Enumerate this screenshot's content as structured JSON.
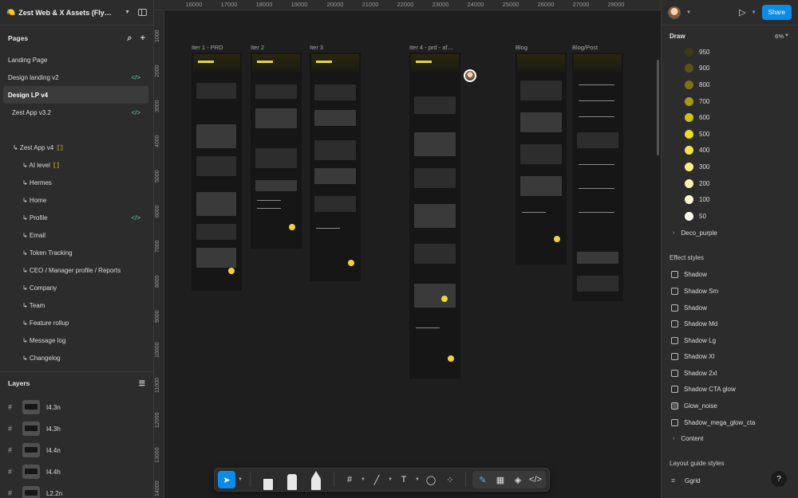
{
  "file": {
    "title": "Zest Web & X Assets (Fly…",
    "emoji_icon": "lemon-icon"
  },
  "pages": {
    "heading": "Pages",
    "items": [
      {
        "label": "Landing Page"
      },
      {
        "label": "Design landing v2"
      },
      {
        "label": "Design LP v4"
      },
      {
        "label": "Zest App v3.2"
      },
      {
        "label": "↳ Zest App v4"
      },
      {
        "label": "↳ AI level"
      },
      {
        "label": "↳ Hermes"
      },
      {
        "label": "↳ Home"
      },
      {
        "label": "↳ Profile"
      },
      {
        "label": "↳ Email"
      },
      {
        "label": "↳ Token Tracking"
      },
      {
        "label": "↳ CEO / Manager profile / Reports"
      },
      {
        "label": "↳ Company"
      },
      {
        "label": "↳ Team"
      },
      {
        "label": "↳ Feature rollup"
      },
      {
        "label": "↳ Message log"
      },
      {
        "label": "↳ Changelog"
      }
    ]
  },
  "layers": {
    "heading": "Layers",
    "items": [
      {
        "label": "I4.3n"
      },
      {
        "label": "I4.3h"
      },
      {
        "label": "I4.4n"
      },
      {
        "label": "I4.4h"
      },
      {
        "label": "L2.2n"
      }
    ]
  },
  "canvas": {
    "ruler_x": [
      "16000",
      "17000",
      "18000",
      "19000",
      "20000",
      "21000",
      "22000",
      "23000",
      "24000",
      "25000",
      "26000",
      "27000",
      "28000"
    ],
    "ruler_y": [
      "1000",
      "2000",
      "3000",
      "4000",
      "5000",
      "6000",
      "7000",
      "8000",
      "9000",
      "10000",
      "11000",
      "12000",
      "13000",
      "14000"
    ],
    "frames": [
      {
        "label": "Iter 1 - PRD"
      },
      {
        "label": "Iter 2"
      },
      {
        "label": "Iter 3"
      },
      {
        "label": "Iter 4 - prd - af…"
      },
      {
        "label": "Blog"
      },
      {
        "label": "Blog/Post"
      }
    ]
  },
  "right_panel": {
    "share_label": "Share",
    "draw_label": "Draw",
    "zoom": "6%",
    "swatches": [
      {
        "label": "950",
        "color": "#3d3a16"
      },
      {
        "label": "900",
        "color": "#5a5418"
      },
      {
        "label": "800",
        "color": "#7c7418"
      },
      {
        "label": "700",
        "color": "#a29a19"
      },
      {
        "label": "600",
        "color": "#cfc11c"
      },
      {
        "label": "500",
        "color": "#ecdc22"
      },
      {
        "label": "400",
        "color": "#f4e54a"
      },
      {
        "label": "300",
        "color": "#f8ee84"
      },
      {
        "label": "200",
        "color": "#fbf4b4"
      },
      {
        "label": "100",
        "color": "#fdf9d8"
      },
      {
        "label": "50",
        "color": "#fffdf0"
      }
    ],
    "deco_label": "Deco_purple",
    "effect_heading": "Effect styles",
    "effects": [
      {
        "label": "Shadow"
      },
      {
        "label": "Shadow Sm"
      },
      {
        "label": "Shadow"
      },
      {
        "label": "Shadow Md"
      },
      {
        "label": "Shadow Lg"
      },
      {
        "label": "Shadow Xl"
      },
      {
        "label": "Shadow 2xl"
      },
      {
        "label": "Shadow CTA glow"
      },
      {
        "label": "Glow_noise"
      },
      {
        "label": "Shadow_mega_glow_cta"
      }
    ],
    "content_label": "Content",
    "layout_heading": "Layout guide styles",
    "grid_label": "Ggrid",
    "help_label": "?"
  },
  "colors": {
    "accent": "#0c8ce9",
    "brand_yellow": "#e9d43a"
  }
}
